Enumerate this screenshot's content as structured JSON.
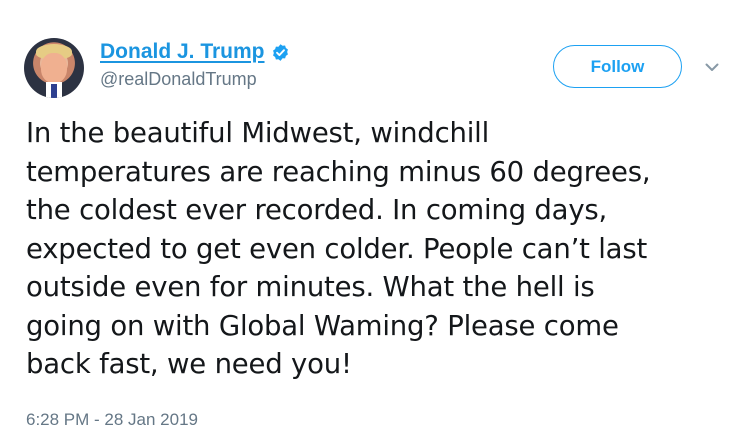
{
  "user": {
    "display_name": "Donald J. Trump",
    "handle": "@realDonaldTrump",
    "verified": true
  },
  "actions": {
    "follow_label": "Follow"
  },
  "tweet": {
    "text": "In the beautiful Midwest, windchill\ntemperatures are reaching minus 60 degrees,\nthe coldest ever recorded. In coming days,\nexpected to get even colder. People can’t last\noutside even for minutes. What the hell is\ngoing on with Global Waming? Please come\nback fast, we need you!",
    "timestamp": "6:28 PM - 28 Jan 2019"
  },
  "icons": {
    "verified": "verified-badge-icon",
    "caret": "chevron-down-icon"
  },
  "colors": {
    "link_blue": "#1b95e0",
    "accent_blue": "#1da1f2",
    "secondary_text": "#657786",
    "primary_text": "#14171a"
  }
}
